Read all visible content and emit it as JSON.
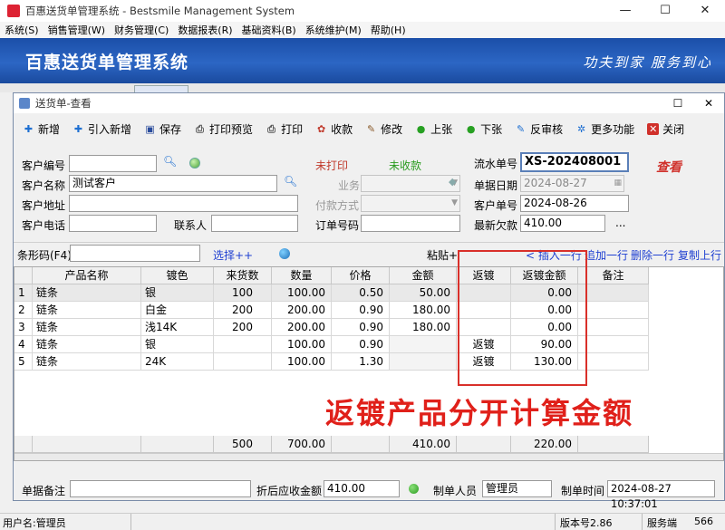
{
  "app": {
    "window_title": "百惠送货单管理系统 - Bestsmile Management System",
    "menu": [
      "系统(S)",
      "销售管理(W)",
      "财务管理(C)",
      "数据报表(R)",
      "基础资料(B)",
      "系统维护(M)",
      "帮助(H)"
    ],
    "banner_title": "百惠送货单管理系统",
    "slogan": "功夫到家 服务到心"
  },
  "dialog": {
    "title": "送货单-查看",
    "toolbar": [
      {
        "label": "新增",
        "icon": "plus-icon"
      },
      {
        "label": "引入新增",
        "icon": "plus-icon"
      },
      {
        "label": "保存",
        "icon": "save-icon"
      },
      {
        "label": "打印预览",
        "icon": "print-preview-icon"
      },
      {
        "label": "打印",
        "icon": "print-icon"
      },
      {
        "label": "收款",
        "icon": "receive-icon"
      },
      {
        "label": "修改",
        "icon": "edit-icon"
      },
      {
        "label": "上张",
        "icon": "prev-icon"
      },
      {
        "label": "下张",
        "icon": "next-icon"
      },
      {
        "label": "反审核",
        "icon": "unapprove-icon"
      },
      {
        "label": "更多功能",
        "icon": "more-icon"
      },
      {
        "label": "关闭",
        "icon": "close-icon"
      }
    ],
    "form": {
      "customer_code_label": "客户编号",
      "customer_code": "",
      "customer_name_label": "客户名称",
      "customer_name": "测试客户",
      "customer_addr_label": "客户地址",
      "customer_addr": "",
      "customer_phone_label": "客户电话",
      "customer_phone": "",
      "contact_label": "联系人",
      "contact": "",
      "print_status": "未打印",
      "pay_status": "未收款",
      "salesman_label": "业务员",
      "pay_method_label": "付款方式",
      "order_no_label": "订单号码",
      "order_no": "",
      "serial_label": "流水单号",
      "serial": "XS-202408001",
      "view_status": "查看",
      "date_label": "单据日期",
      "date": "2024-08-27",
      "cust_order_label": "客户单号",
      "cust_order": "2024-08-26",
      "owed_label": "最新欠款",
      "owed": "410.00",
      "ellipsis": "..."
    },
    "barcode_label": "条形码(F4)",
    "barcode_value": "",
    "select_link": "选择++",
    "paste_label": "粘贴+",
    "row_actions": [
      "插入一行",
      "追加一行",
      "删除一行",
      "复制上行"
    ],
    "columns": [
      "",
      "产品名称",
      "镀色",
      "来货数",
      "数量",
      "价格",
      "金额",
      "返镀",
      "返镀金额",
      "备注"
    ],
    "rows": [
      {
        "idx": "1",
        "name": "链条",
        "color": "银",
        "incoming": "100",
        "qty": "100.00",
        "price": "0.50",
        "amount": "50.00",
        "replate": "",
        "replate_amt": "0.00",
        "note": ""
      },
      {
        "idx": "2",
        "name": "链条",
        "color": "白金",
        "incoming": "200",
        "qty": "200.00",
        "price": "0.90",
        "amount": "180.00",
        "replate": "",
        "replate_amt": "0.00",
        "note": ""
      },
      {
        "idx": "3",
        "name": "链条",
        "color": "浅14K",
        "incoming": "200",
        "qty": "200.00",
        "price": "0.90",
        "amount": "180.00",
        "replate": "",
        "replate_amt": "0.00",
        "note": ""
      },
      {
        "idx": "4",
        "name": "链条",
        "color": "银",
        "incoming": "",
        "qty": "100.00",
        "price": "0.90",
        "amount": "",
        "replate": "返镀",
        "replate_amt": "90.00",
        "note": ""
      },
      {
        "idx": "5",
        "name": "链条",
        "color": "24K",
        "incoming": "",
        "qty": "100.00",
        "price": "1.30",
        "amount": "",
        "replate": "返镀",
        "replate_amt": "130.00",
        "note": ""
      }
    ],
    "totals": {
      "incoming": "500",
      "qty": "700.00",
      "amount": "410.00",
      "replate_amt": "220.00"
    },
    "annotation": "返镀产品分开计算金额",
    "bottom": {
      "remark_label": "单据备注",
      "remark": "",
      "receivable_label": "折后应收金额",
      "receivable": "410.00",
      "maker_label": "制单人员",
      "maker": "管理员",
      "make_time_label": "制单时间",
      "make_time": "2024-08-27 10:37:01"
    }
  },
  "status": {
    "user": "用户名:管理员",
    "version": "版本号2.86",
    "server": "服务端",
    "code": "566"
  }
}
